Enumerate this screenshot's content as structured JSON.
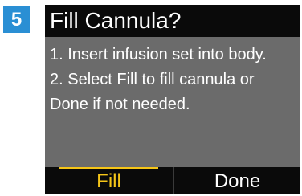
{
  "step": {
    "number": "5",
    "badge_color": "#2a8fd4"
  },
  "screen": {
    "title": "Fill Cannula?",
    "message_lines": [
      "1. Insert infusion set into body.",
      "2. Select Fill to fill cannula or",
      "Done if not needed."
    ]
  },
  "softkeys": {
    "left": {
      "label": "Fill",
      "selected": true,
      "color": "#f5c518"
    },
    "right": {
      "label": "Done",
      "selected": false,
      "color": "#ffffff"
    }
  },
  "colors": {
    "screen_background": "#6b6b6b",
    "bar_background": "#0a0a0a",
    "text": "#ffffff",
    "highlight": "#f5c518"
  }
}
